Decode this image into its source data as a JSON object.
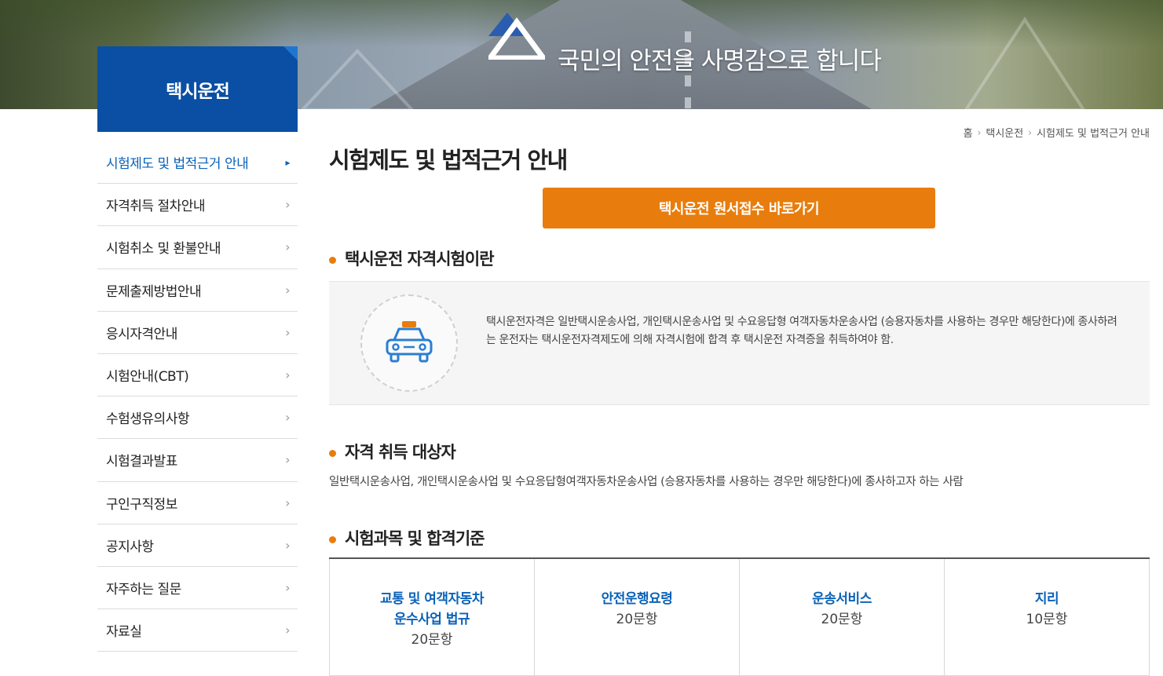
{
  "banner": {
    "slogan": "국민의 안전을 사명감으로 합니다"
  },
  "section": {
    "title": "택시운전"
  },
  "sidebar": {
    "items": [
      {
        "label": "시험제도 및 법적근거 안내",
        "active": true
      },
      {
        "label": "자격취득 절차안내",
        "active": false
      },
      {
        "label": "시험취소 및 환불안내",
        "active": false
      },
      {
        "label": "문제출제방법안내",
        "active": false
      },
      {
        "label": "응시자격안내",
        "active": false
      },
      {
        "label": "시험안내(CBT)",
        "active": false
      },
      {
        "label": "수험생유의사항",
        "active": false
      },
      {
        "label": "시험결과발표",
        "active": false
      },
      {
        "label": "구인구직정보",
        "active": false
      },
      {
        "label": "공지사항",
        "active": false
      },
      {
        "label": "자주하는 질문",
        "active": false
      },
      {
        "label": "자료실",
        "active": false
      }
    ]
  },
  "breadcrumb": [
    "홈",
    "택시운전",
    "시험제도 및 법적근거 안내"
  ],
  "page": {
    "title": "시험제도 및 법적근거 안내",
    "apply_button": "택시운전 원서접수 바로가기"
  },
  "intro": {
    "heading": "택시운전 자격시험이란",
    "text": "택시운전자격은 일반택시운송사업, 개인택시운송사업 및 수요응답형 여객자동차운송사업 (승용자동차를 사용하는 경우만 해당한다)에 종사하려는 운전자는 택시운전자격제도에 의해 자격시험에 합격 후 택시운전 자격증을 취득하여야 함."
  },
  "target": {
    "heading": "자격 취득 대상자",
    "text": "일반택시운송사업, 개인택시운송사업 및 수요응답형여객자동차운송사업 (승용자동차를 사용하는 경우만 해당한다)에 종사하고자 하는 사람"
  },
  "subjects": {
    "heading": "시험과목 및 합격기준",
    "items": [
      {
        "name_line1": "교통 및 여객자동차",
        "name_line2": "운수사업 법규",
        "count": "20문항"
      },
      {
        "name_line1": "안전운행요령",
        "name_line2": "",
        "count": "20문항"
      },
      {
        "name_line1": "운송서비스",
        "name_line2": "",
        "count": "20문항"
      },
      {
        "name_line1": "지리",
        "name_line2": "",
        "count": "10문항"
      }
    ]
  },
  "colors": {
    "brand_blue": "#0a4fa3",
    "accent_orange": "#e87d0d",
    "link_blue": "#0a62b8"
  }
}
